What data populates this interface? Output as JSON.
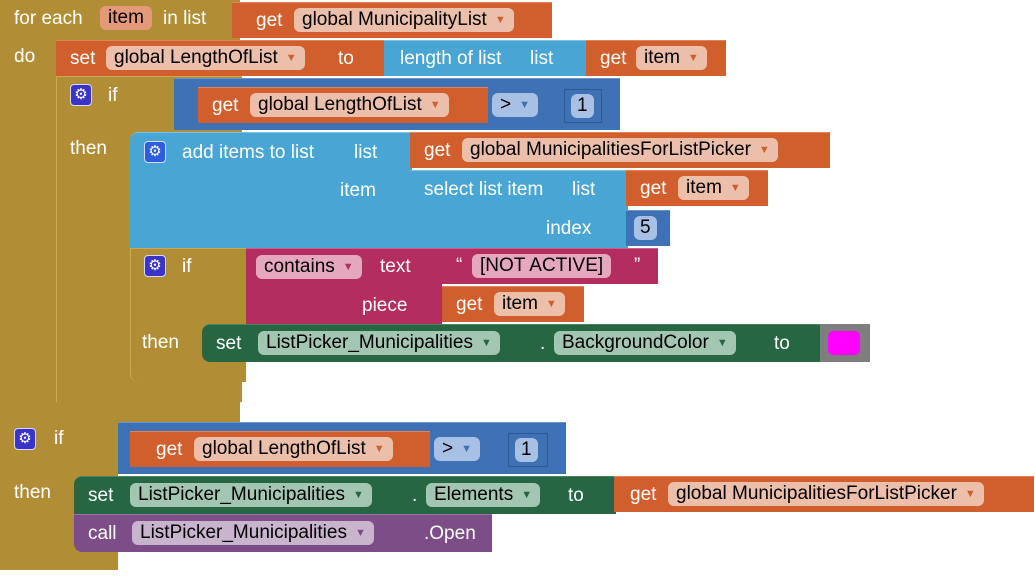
{
  "for_each": {
    "label_for_each": "for each",
    "var_name": "item",
    "label_in_list": "in list",
    "label_do": "do",
    "list_getter": {
      "label": "get",
      "var": "global MunicipalityList"
    }
  },
  "set_length": {
    "label_set": "set",
    "var": "global LengthOfList",
    "label_to": "to",
    "length_label": "length of list",
    "length_socket": "list",
    "getter": {
      "label": "get",
      "var": "item"
    }
  },
  "if1": {
    "label_if": "if",
    "label_then": "then",
    "getter": {
      "label": "get",
      "var": "global LengthOfList"
    },
    "op": ">",
    "number": "1"
  },
  "add_items": {
    "label": "add items to list",
    "socket_list": "list",
    "socket_item": "item",
    "list_getter": {
      "label": "get",
      "var": "global MunicipalitiesForListPicker"
    },
    "select": {
      "label": "select list item",
      "socket_list": "list",
      "socket_index": "index",
      "getter": {
        "label": "get",
        "var": "item"
      },
      "index": "5"
    }
  },
  "if2": {
    "label_if": "if",
    "label_then": "then",
    "contains_op": "contains",
    "socket_text": "text",
    "socket_piece": "piece",
    "text_open_quote": "“",
    "text_value": "[NOT ACTIVE]",
    "text_close_quote": "”",
    "piece_getter": {
      "label": "get",
      "var": "item"
    },
    "set_bg": {
      "label_set": "set",
      "component": "ListPicker_Municipalities",
      "dot": ".",
      "property": "BackgroundColor",
      "label_to": "to",
      "color": "#ff00ff"
    }
  },
  "if3": {
    "label_if": "if",
    "label_then": "then",
    "getter": {
      "label": "get",
      "var": "global LengthOfList"
    },
    "op": ">",
    "number": "1",
    "set_elements": {
      "label_set": "set",
      "component": "ListPicker_Municipalities",
      "dot": ".",
      "property": "Elements",
      "label_to": "to",
      "getter": {
        "label": "get",
        "var": "global MunicipalitiesForListPicker"
      }
    },
    "call_open": {
      "label_call": "call",
      "component": "ListPicker_Municipalities",
      "method": ".Open"
    }
  },
  "icons": {
    "gear": "⚙",
    "dropdown": "▼"
  }
}
